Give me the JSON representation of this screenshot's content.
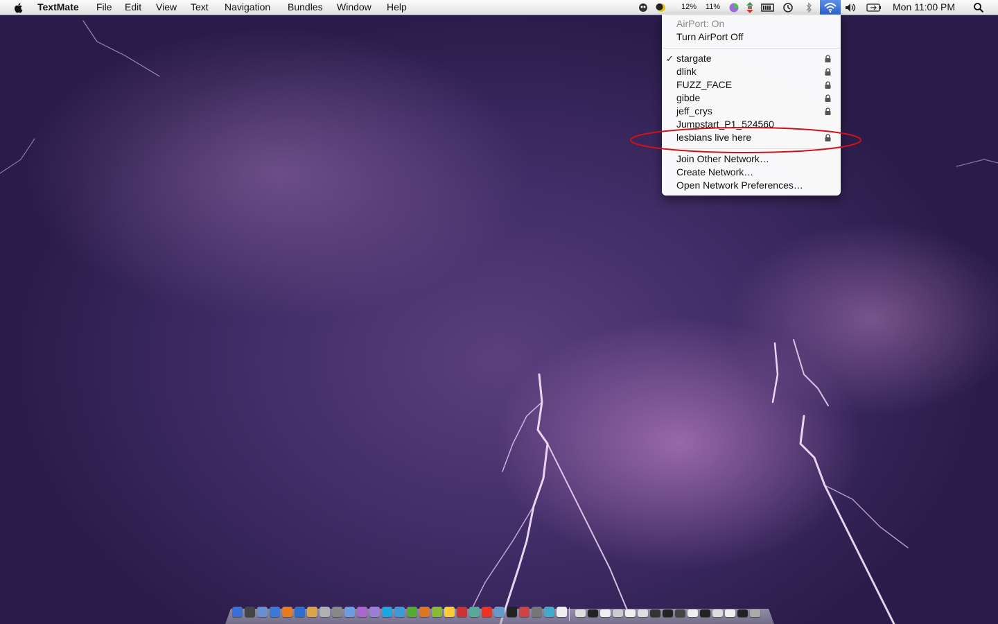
{
  "menubar": {
    "app_name": "TextMate",
    "menus": [
      "File",
      "Edit",
      "View",
      "Text",
      "Navigation",
      "Bundles",
      "Window",
      "Help"
    ],
    "status": {
      "cpu1": "12%",
      "cpu2": "11%",
      "clock": "Mon 11:00 PM"
    }
  },
  "airport_menu": {
    "status": "AirPort: On",
    "toggle": "Turn AirPort Off",
    "networks": [
      {
        "name": "stargate",
        "selected": true,
        "secured": true
      },
      {
        "name": "dlink",
        "selected": false,
        "secured": true
      },
      {
        "name": "FUZZ_FACE",
        "selected": false,
        "secured": true
      },
      {
        "name": "gibde",
        "selected": false,
        "secured": true
      },
      {
        "name": "jeff_crys",
        "selected": false,
        "secured": true
      },
      {
        "name": "Jumpstart_P1_524560",
        "selected": false,
        "secured": false
      },
      {
        "name": "lesbians live here",
        "selected": false,
        "secured": true
      }
    ],
    "actions": [
      "Join Other Network…",
      "Create Network…",
      "Open Network Preferences…"
    ],
    "checkmark": "✓"
  },
  "annotation": {
    "color": "#d0121b",
    "target": "lesbians live here"
  },
  "colors": {
    "menubar": "#ececec",
    "airport_highlight": "#2c63d4",
    "wallpaper": "#3d2a63"
  },
  "icons": {
    "apple": "apple-logo-icon",
    "status_icons": [
      "adium-icon",
      "moon-icon",
      "cpu-pie-icon",
      "network-arrows-icon",
      "battery-meter-icon",
      "time-machine-icon",
      "bluetooth-icon",
      "wifi-icon",
      "volume-icon",
      "battery-icon",
      "spotlight-icon"
    ],
    "lock": "lock-icon"
  },
  "dock": {
    "app_icon_colors": [
      "#3a6fd8",
      "#444",
      "#6a8fd0",
      "#3b7ad6",
      "#e87b1e",
      "#2d6fd0",
      "#d8a54a",
      "#b0b0b0",
      "#888",
      "#6f9be0",
      "#aa66cc",
      "#9b7fd4",
      "#1fa6e0",
      "#3c9ad6",
      "#55aa33",
      "#dd7722",
      "#88bb33",
      "#ffcc33",
      "#cc3333",
      "#55aa99",
      "#ee3322",
      "#6699cc",
      "#222",
      "#cc4444",
      "#777",
      "#44aacc",
      "#eeeeee"
    ],
    "doc_icon_colors": [
      "#ddd",
      "#222",
      "#eee",
      "#ccc",
      "#eee",
      "#ddd",
      "#333",
      "#222",
      "#444",
      "#eee",
      "#222",
      "#ddd",
      "#eee",
      "#222",
      "#aaa"
    ]
  }
}
